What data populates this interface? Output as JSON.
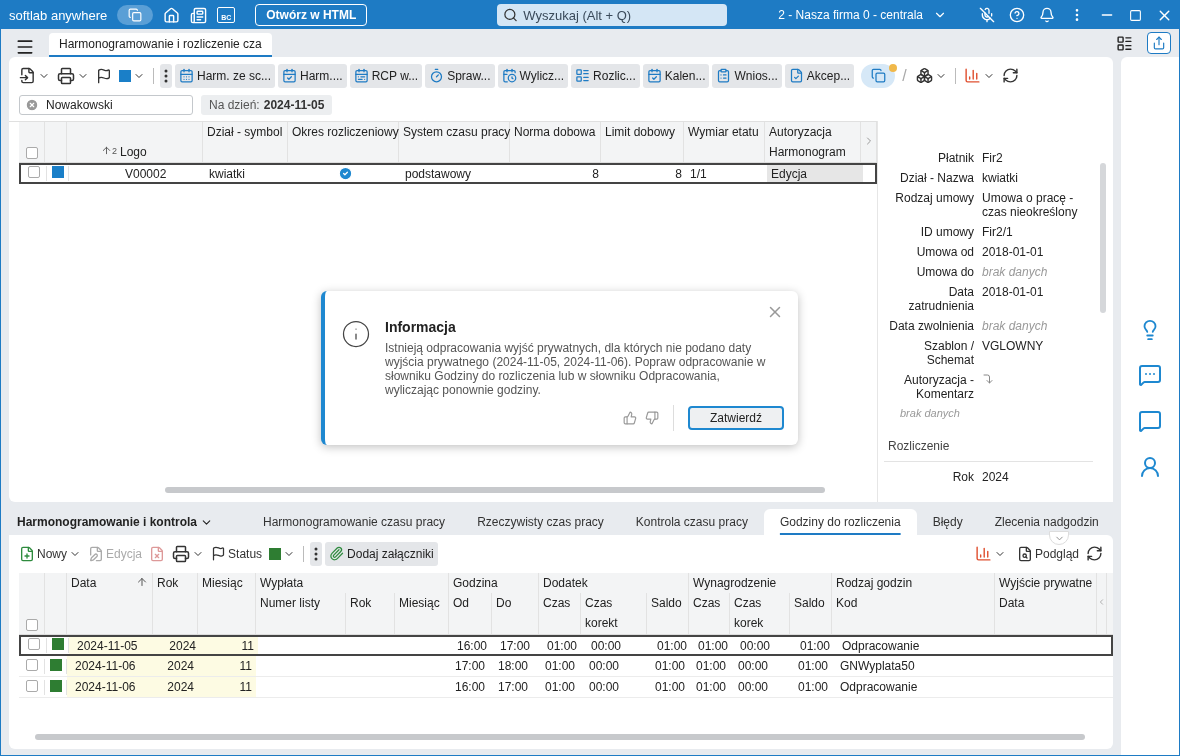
{
  "app": {
    "title": "softlab anywhere",
    "bc_label": "BC",
    "open_html": "Otwórz w HTML",
    "search_placeholder": "Wyszukaj (Alt + Q)",
    "company": "2 - Nasza firma 0 - centrala"
  },
  "document_tab": {
    "label": "Harmonogramowanie i rozliczenie cza",
    "selected": true
  },
  "toolbar": {
    "separator": "/",
    "buttons": [
      {
        "label": "Harm. ze sc..."
      },
      {
        "label": "Harm...."
      },
      {
        "label": "RCP w..."
      },
      {
        "label": "Spraw..."
      },
      {
        "label": "Wylicz..."
      },
      {
        "label": "Rozlic..."
      },
      {
        "label": "Kalen..."
      },
      {
        "label": "Wnios..."
      },
      {
        "label": "Akcep..."
      }
    ]
  },
  "filter": {
    "value": "Nowakowski",
    "date_label": "Na dzień:",
    "date": "2024-11-05"
  },
  "upper_grid": {
    "all_checked": false,
    "columns": [
      {
        "label": "Logo",
        "sort_index": "2"
      },
      {
        "label": "Dział - symbol"
      },
      {
        "label": "Okres rozliczeniowy"
      },
      {
        "label": "System czasu pracy"
      },
      {
        "label": "Norma dobowa"
      },
      {
        "label": "Limit dobowy"
      },
      {
        "label": "Wymiar etatu"
      },
      {
        "label": "Autoryzacja",
        "sub": "Harmonogram"
      }
    ],
    "rows": [
      {
        "selected": true,
        "checked": false,
        "color": "#1a7fc8",
        "code": "V00002",
        "department": "kwiatki",
        "period_set": true,
        "system": "podstawowy",
        "norm": "8",
        "limit": "8",
        "fte": "1/1",
        "authorization": "Edycja"
      }
    ]
  },
  "details": {
    "rows": [
      {
        "kind": "text",
        "label": "Płatnik",
        "value": "Fir2"
      },
      {
        "kind": "text",
        "label": "Dział - Nazwa",
        "value": "kwiatki"
      },
      {
        "kind": "text",
        "label": "Rodzaj umowy",
        "value": "Umowa o pracę - czas nieokreślony"
      },
      {
        "kind": "text",
        "label": "ID umowy",
        "value": "Fir2/1"
      },
      {
        "kind": "text",
        "label": "Umowa od",
        "value": "2018-01-01"
      },
      {
        "kind": "empty",
        "label": "Umowa do",
        "value": "brak danych"
      },
      {
        "kind": "text",
        "label": "Data zatrudnienia",
        "value": "2018-01-01"
      },
      {
        "kind": "empty",
        "label": "Data zwolnienia",
        "value": "brak danych"
      },
      {
        "kind": "text",
        "label": "Szablon / Schemat",
        "value": "VGLOWNY"
      },
      {
        "kind": "icon",
        "label": "Autoryzacja - Komentarz"
      },
      {
        "kind": "note",
        "value": "brak danych"
      },
      {
        "kind": "section",
        "value": "Rozliczenie"
      },
      {
        "kind": "text",
        "label": "Rok",
        "value": "2024"
      }
    ]
  },
  "dialog": {
    "title": "Informacja",
    "message": "Istnieją odpracowania wyjść prywatnych, dla których nie podano daty wyjścia prywatnego (2024-11-05, 2024-11-06). Popraw odpracowanie w słowniku Godziny do rozliczenia lub w słowniku Odpracowania, wyliczając ponownie godziny.",
    "confirm": "Zatwierdź"
  },
  "bottom": {
    "module": "Harmonogramowanie i kontrola",
    "tabs": [
      {
        "label": "Harmonogramowanie czasu pracy",
        "selected": false
      },
      {
        "label": "Rzeczywisty czas pracy",
        "selected": false
      },
      {
        "label": "Kontrola czasu pracy",
        "selected": false
      },
      {
        "label": "Godziny do rozliczenia",
        "selected": true
      },
      {
        "label": "Błędy",
        "selected": false
      },
      {
        "label": "Zlecenia nadgodzin",
        "selected": false
      }
    ],
    "toolbar": {
      "new": "Nowy",
      "edit": "Edycja",
      "edit_disabled": true,
      "status": "Status",
      "attach": "Dodaj załączniki",
      "preview": "Podgląd"
    }
  },
  "lower_grid": {
    "all_checked": false,
    "columns": [
      {
        "label": "Data",
        "sorted": true
      },
      {
        "label": "Rok"
      },
      {
        "label": "Miesiąc"
      },
      {
        "label": "Wypłata",
        "sub": [
          "Numer listy",
          "Rok",
          "Miesiąc"
        ]
      },
      {
        "label": "Godzina",
        "sub": [
          "Od",
          "Do"
        ]
      },
      {
        "label": "Dodatek",
        "sub": [
          "Czas",
          "Czas korekt",
          "Saldo"
        ]
      },
      {
        "label": "Wynagrodzenie",
        "sub": [
          "Czas",
          "Czas korek",
          "Saldo"
        ]
      },
      {
        "label": "Rodzaj godzin",
        "sub": [
          "Kod"
        ]
      },
      {
        "label": "Wyjście prywatne",
        "sub": [
          "Data"
        ]
      }
    ],
    "rows": [
      {
        "selected": true,
        "checked": false,
        "color": "#2e7d32",
        "date": "2024-11-05",
        "year": "2024",
        "month": "11",
        "from": "16:00",
        "to": "17:00",
        "extra_time": "01:00",
        "extra_correction": "00:00",
        "extra_balance": "01:00",
        "pay_time": "01:00",
        "pay_correction": "00:00",
        "pay_balance": "01:00",
        "code": "Odpracowanie"
      },
      {
        "selected": false,
        "checked": false,
        "color": "#2e7d32",
        "date": "2024-11-06",
        "year": "2024",
        "month": "11",
        "from": "17:00",
        "to": "18:00",
        "extra_time": "01:00",
        "extra_correction": "00:00",
        "extra_balance": "01:00",
        "pay_time": "01:00",
        "pay_correction": "00:00",
        "pay_balance": "01:00",
        "code": "GNWyplata50"
      },
      {
        "selected": false,
        "checked": false,
        "color": "#2e7d32",
        "date": "2024-11-06",
        "year": "2024",
        "month": "11",
        "from": "16:00",
        "to": "17:00",
        "extra_time": "01:00",
        "extra_correction": "00:00",
        "extra_balance": "01:00",
        "pay_time": "01:00",
        "pay_correction": "00:00",
        "pay_balance": "01:00",
        "code": "Odpracowanie"
      }
    ]
  }
}
